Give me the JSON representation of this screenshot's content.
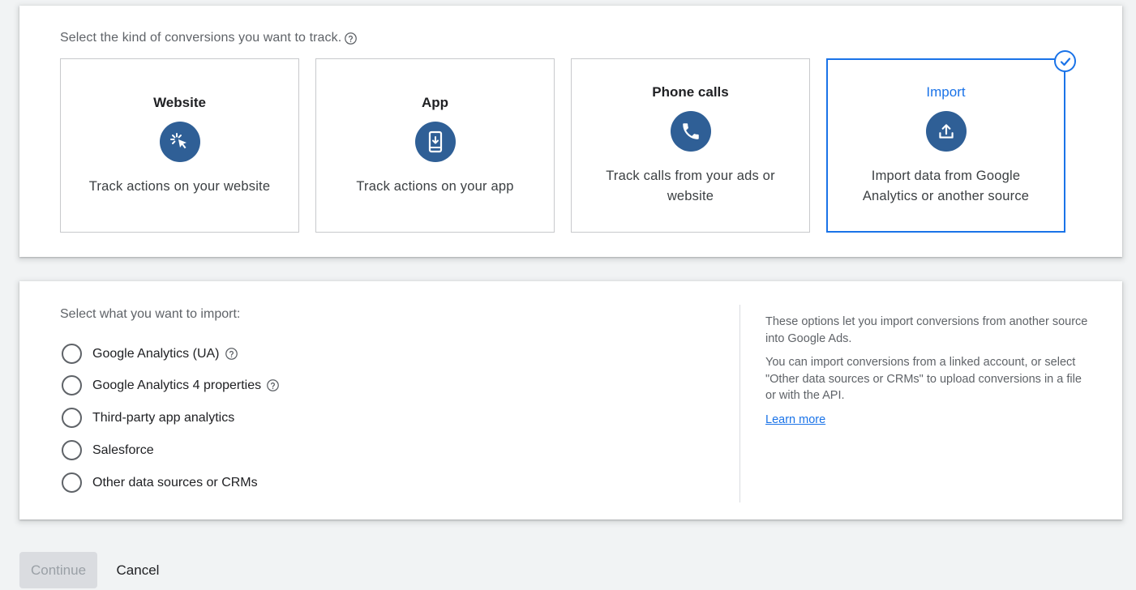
{
  "kind_section": {
    "title": "Select the kind of conversions you want to track.",
    "tiles": [
      {
        "title": "Website",
        "icon": "cursor-click-icon",
        "description": "Track actions on your website",
        "selected": false
      },
      {
        "title": "App",
        "icon": "phone-download-icon",
        "description": "Track actions on your app",
        "selected": false
      },
      {
        "title": "Phone calls",
        "icon": "phone-icon",
        "description": "Track calls from your ads or website",
        "selected": false
      },
      {
        "title": "Import",
        "icon": "upload-icon",
        "description": "Import data from Google Analytics or another source",
        "selected": true
      }
    ]
  },
  "import_section": {
    "title": "Select what you want to import:",
    "options": [
      {
        "label": "Google Analytics (UA)",
        "has_help": true,
        "selected": false
      },
      {
        "label": "Google Analytics 4 properties",
        "has_help": true,
        "selected": false
      },
      {
        "label": "Third-party app analytics",
        "has_help": false,
        "selected": false
      },
      {
        "label": "Salesforce",
        "has_help": false,
        "selected": false
      },
      {
        "label": "Other data sources or CRMs",
        "has_help": false,
        "selected": false
      }
    ],
    "info": {
      "paragraph1": "These options let you import conversions from another source into Google Ads.",
      "paragraph2": "You can import conversions from a linked account, or select \"Other data sources or CRMs\" to upload conversions in a file or with the API.",
      "link": "Learn more"
    }
  },
  "actions": {
    "continue_label": "Continue",
    "cancel_label": "Cancel"
  },
  "colors": {
    "accent": "#1a73e8",
    "icon_circle": "#2f5f96",
    "background": "#f1f3f4"
  }
}
